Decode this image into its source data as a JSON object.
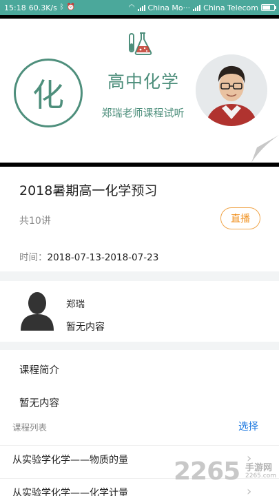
{
  "status_bar": {
    "time": "15:18",
    "speed": "60.3K/s",
    "carrier1": "China Mo···",
    "carrier2": "China Telecom",
    "battery_level": 0.7
  },
  "banner": {
    "logo_char": "化",
    "title": "高中化学",
    "subtitle": "郑瑞老师课程试听"
  },
  "course": {
    "title": "2018暑期高一化学预习",
    "lesson_count": "共10讲",
    "live_label": "直播",
    "date_label": "时间：",
    "date_value": "2018-07-13-2018-07-23"
  },
  "teacher": {
    "name": "郑瑞",
    "description": "暂无内容"
  },
  "intro": {
    "heading": "课程简介",
    "body": "暂无内容"
  },
  "lessons": {
    "heading": "课程列表",
    "select_label": "选择",
    "items": [
      {
        "title": "从实验学化学——物质的量"
      },
      {
        "title": "从实验学化学——化学计量"
      }
    ]
  },
  "watermark": {
    "number": "2265",
    "name": "手游网",
    "url": "2265.com"
  },
  "colors": {
    "status_bar": "#4ba89b",
    "banner_green": "#4e8f7c",
    "live_orange": "#f08f1c",
    "link_blue": "#1f7ae0"
  }
}
